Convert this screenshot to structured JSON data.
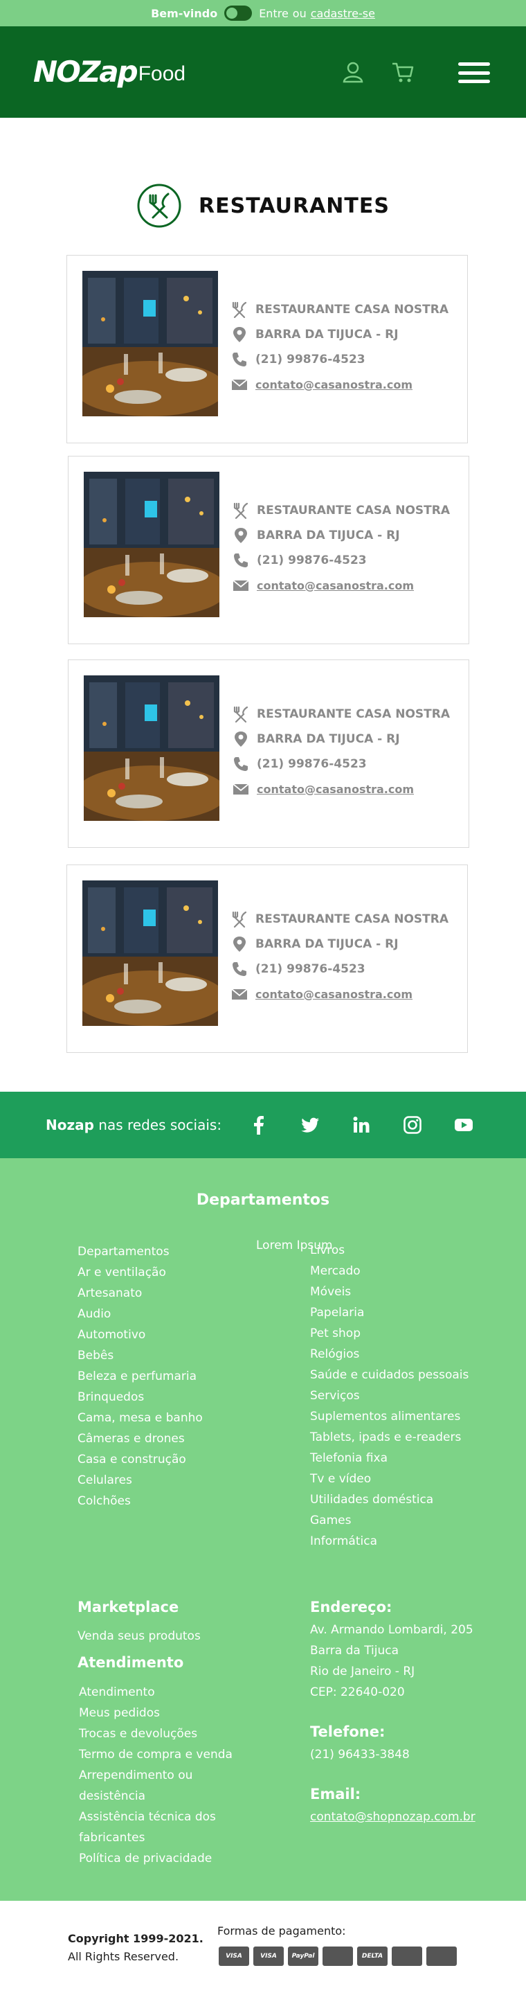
{
  "topbar": {
    "welcome": "Bem-vindo",
    "enter": "Entre",
    "or": "ou",
    "register": "cadastre-se"
  },
  "header": {
    "logo_main": "NOZap",
    "logo_sub": "Food",
    "icons": [
      "user-icon",
      "cart-icon",
      "menu-icon"
    ]
  },
  "page": {
    "title": "RESTAURANTES"
  },
  "restaurants": [
    {
      "name": "RESTAURANTE CASA NOSTRA",
      "location": "BARRA DA TIJUCA - RJ",
      "phone": "(21) 99876-4523",
      "email": "contato@casanostra.com"
    },
    {
      "name": "RESTAURANTE CASA NOSTRA",
      "location": "BARRA DA TIJUCA - RJ",
      "phone": "(21) 99876-4523",
      "email": "contato@casanostra.com"
    },
    {
      "name": "RESTAURANTE CASA NOSTRA",
      "location": "BARRA DA TIJUCA - RJ",
      "phone": "(21) 99876-4523",
      "email": "contato@casanostra.com"
    },
    {
      "name": "RESTAURANTE CASA NOSTRA",
      "location": "BARRA DA TIJUCA - RJ",
      "phone": "(21) 99876-4523",
      "email": "contato@casanostra.com"
    }
  ],
  "social": {
    "brand": "Nozap",
    "label": "nas redes sociais:",
    "icons": [
      "facebook-icon",
      "twitter-icon",
      "linkedin-icon",
      "instagram-icon",
      "youtube-icon"
    ]
  },
  "footer": {
    "departments_title": "Departamentos",
    "lorem": "Lorem Ipsum",
    "departments_left": [
      "Departamentos",
      "Ar e ventilação",
      "Artesanato",
      "Audio",
      "Automotivo",
      "Bebês",
      "Beleza e perfumaria",
      "Brinquedos",
      "Cama, mesa e banho",
      "Câmeras e drones",
      "Casa e construção",
      "Celulares",
      "Colchões"
    ],
    "departments_right": [
      "Livros",
      "Mercado",
      "Móveis",
      "Papelaria",
      "Pet shop",
      "Relógios",
      "Saúde e cuidados pessoais",
      "Serviços",
      "Suplementos alimentares",
      "Tablets, ipads e e-readers",
      "Telefonia fixa",
      "Tv e vídeo",
      "Utilidades doméstica",
      "Games",
      "Informática"
    ],
    "marketplace_title": "Marketplace",
    "marketplace_link": "Venda seus produtos",
    "service_title": "Atendimento",
    "service_links": [
      "Atendimento",
      "Meus pedidos",
      "Trocas e devoluções",
      "Termo de compra e venda",
      "Arrependimento ou",
      "desistência",
      "Assistência técnica dos",
      "fabricantes",
      "Política de privacidade"
    ],
    "address_title": "Endereço:",
    "address_lines": [
      "Av. Armando Lombardi, 205",
      "Barra da Tijuca",
      "Rio de Janeiro - RJ",
      "CEP: 22640-020"
    ],
    "phone_title": "Telefone:",
    "phone": "(21) 96433-3848",
    "email_title": "Email:",
    "email": "contato@shopnozap.com.br"
  },
  "bottom": {
    "copyright": "Copyright 1999-2021.",
    "rights": "All Rights Reserved.",
    "payment_label": "Formas de pagamento:",
    "payment_methods": [
      "VISA",
      "VISA",
      "PayPal",
      "",
      "DELTA",
      "",
      ""
    ]
  },
  "colors": {
    "topbar": "#7ccf86",
    "header": "#0b6623",
    "social": "#1e9e5a",
    "footer": "#7dd387",
    "card_text": "#8a8a8a"
  }
}
